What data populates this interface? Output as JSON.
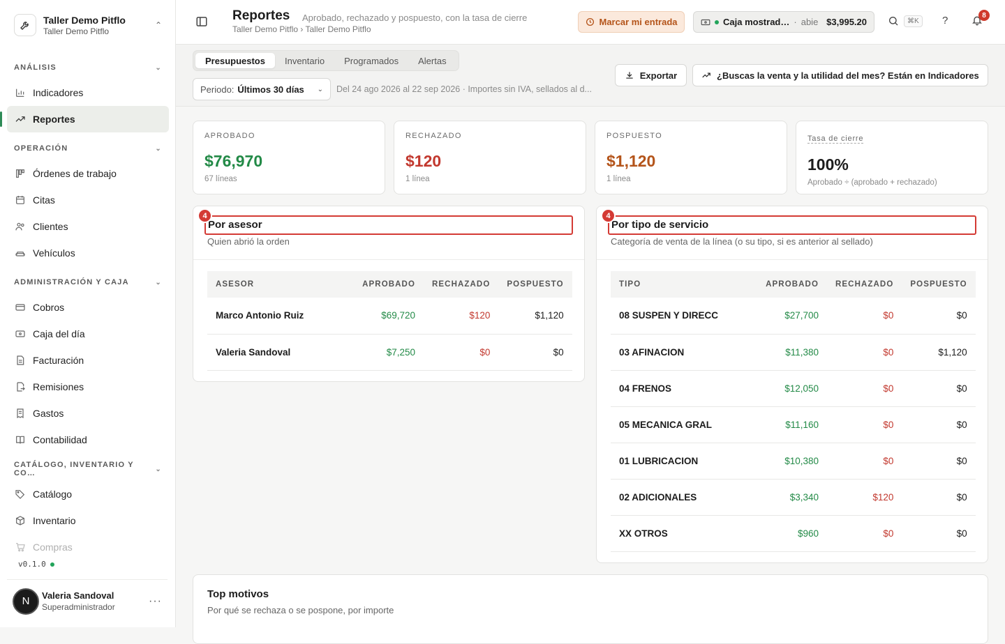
{
  "org": {
    "name": "Taller Demo Pitflo",
    "sub": "Taller Demo Pitflo"
  },
  "sidebar": {
    "sections": [
      {
        "title": "ANÁLISIS",
        "items": [
          {
            "label": "Indicadores",
            "icon": "bar-chart-icon"
          },
          {
            "label": "Reportes",
            "icon": "trending-up-icon",
            "active": true
          }
        ]
      },
      {
        "title": "OPERACIÓN",
        "items": [
          {
            "label": "Órdenes de trabajo",
            "icon": "kanban-icon"
          },
          {
            "label": "Citas",
            "icon": "calendar-icon"
          },
          {
            "label": "Clientes",
            "icon": "users-icon"
          },
          {
            "label": "Vehículos",
            "icon": "car-icon"
          }
        ]
      },
      {
        "title": "ADMINISTRACIÓN Y CAJA",
        "items": [
          {
            "label": "Cobros",
            "icon": "credit-card-icon"
          },
          {
            "label": "Caja del día",
            "icon": "cash-icon"
          },
          {
            "label": "Facturación",
            "icon": "file-text-icon"
          },
          {
            "label": "Remisiones",
            "icon": "file-export-icon"
          },
          {
            "label": "Gastos",
            "icon": "receipt-icon"
          },
          {
            "label": "Contabilidad",
            "icon": "book-icon"
          }
        ]
      },
      {
        "title": "CATÁLOGO, INVENTARIO Y CO…",
        "items": [
          {
            "label": "Catálogo",
            "icon": "tags-icon"
          },
          {
            "label": "Inventario",
            "icon": "box-icon"
          },
          {
            "label": "Compras",
            "icon": "cart-icon",
            "faded": true
          }
        ]
      }
    ],
    "version": "v0.1.0"
  },
  "user": {
    "initial": "N",
    "name": "Valeria Sandoval",
    "role": "Superadministrador"
  },
  "topbar": {
    "title": "Reportes",
    "desc": "Aprobado, rechazado y pospuesto, con la tasa de cierre",
    "crumb": "Taller Demo Pitflo › Taller Demo Pitflo",
    "entrada_label": "Marcar mi entrada",
    "caja_name": "Caja mostrad…",
    "caja_sep": "·",
    "caja_status": "abie",
    "caja_amount": "$3,995.20",
    "kbd": "⌘K",
    "help": "?",
    "notif_count": "8"
  },
  "tabs": [
    "Presupuestos",
    "Inventario",
    "Programados",
    "Alertas"
  ],
  "filters": {
    "periodo_label": "Periodo:",
    "periodo_value": "Últimos 30 días",
    "range_text": "Del 24 ago 2026 al 22 sep 2026 · Importes sin IVA, sellados al d...",
    "export_label": "Exportar",
    "indicadores_label": "¿Buscas la venta y la utilidad del mes? Están en Indicadores"
  },
  "kpis": [
    {
      "label": "APROBADO",
      "value": "$76,970",
      "sub": "67 líneas",
      "color": "#238a47"
    },
    {
      "label": "RECHAZADO",
      "value": "$120",
      "sub": "1 línea",
      "color": "#c2382e"
    },
    {
      "label": "POSPUESTO",
      "value": "$1,120",
      "sub": "1 línea",
      "color": "#b4541a"
    },
    {
      "label": "Tasa de cierre",
      "value": "100%",
      "sub": "Aprobado ÷ (aprobado + rechazado)",
      "color": "#1c1c1c"
    }
  ],
  "asesor": {
    "marker": "4",
    "title": "Por asesor",
    "sub": "Quien abrió la orden",
    "columns": [
      "ASESOR",
      "APROBADO",
      "RECHAZADO",
      "POSPUESTO"
    ],
    "rows": [
      [
        "Marco Antonio Ruiz",
        "$69,720",
        "$120",
        "$1,120"
      ],
      [
        "Valeria Sandoval",
        "$7,250",
        "$0",
        "$0"
      ]
    ]
  },
  "servicio": {
    "marker": "4",
    "title": "Por tipo de servicio",
    "sub": "Categoría de venta de la línea (o su tipo, si es anterior al sellado)",
    "columns": [
      "TIPO",
      "APROBADO",
      "RECHAZADO",
      "POSPUESTO"
    ],
    "rows": [
      [
        "08 SUSPEN Y DIRECC",
        "$27,700",
        "$0",
        "$0"
      ],
      [
        "03 AFINACION",
        "$11,380",
        "$0",
        "$1,120"
      ],
      [
        "04 FRENOS",
        "$12,050",
        "$0",
        "$0"
      ],
      [
        "05 MECANICA GRAL",
        "$11,160",
        "$0",
        "$0"
      ],
      [
        "01 LUBRICACION",
        "$10,380",
        "$0",
        "$0"
      ],
      [
        "02 ADICIONALES",
        "$3,340",
        "$120",
        "$0"
      ],
      [
        "XX OTROS",
        "$960",
        "$0",
        "$0"
      ]
    ]
  },
  "motivos": {
    "title": "Top motivos",
    "sub": "Por qué se rechaza o se pospone, por importe"
  }
}
